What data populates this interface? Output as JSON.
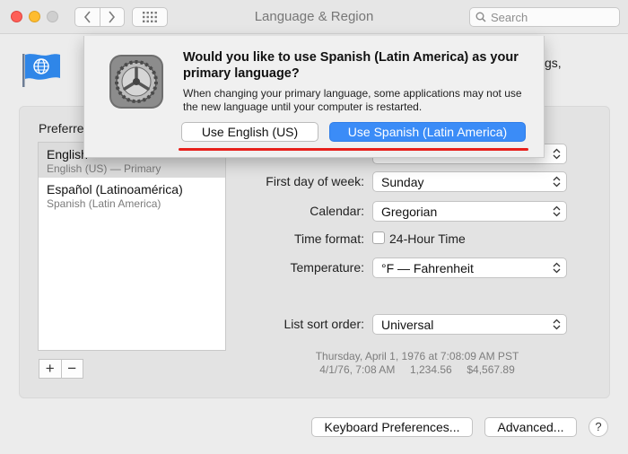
{
  "window": {
    "title": "Language & Region",
    "search_placeholder": "Search"
  },
  "header": {
    "tail_text": "gs,"
  },
  "preferred": {
    "label": "Preferre",
    "languages": [
      {
        "name": "English",
        "subtitle": "English (US) — Primary"
      },
      {
        "name": "Español (Latinoamérica)",
        "subtitle": "Spanish (Latin America)"
      }
    ],
    "add_label": "+",
    "remove_label": "−"
  },
  "settings": {
    "first_day_label": "First day of week:",
    "first_day_value": "Sunday",
    "calendar_label": "Calendar:",
    "calendar_value": "Gregorian",
    "time_format_label": "Time format:",
    "time_format_checkbox": "24-Hour Time",
    "temperature_label": "Temperature:",
    "temperature_value": "°F — Fahrenheit",
    "sort_label": "List sort order:",
    "sort_value": "Universal"
  },
  "sample": {
    "line1": "Thursday, April 1, 1976 at 7:08:09 AM PST",
    "line2": "4/1/76, 7:08 AM     1,234.56     $4,567.89"
  },
  "buttons": {
    "keyboard": "Keyboard Preferences...",
    "advanced": "Advanced...",
    "help": "?"
  },
  "dialog": {
    "title": "Would you like to use Spanish (Latin America) as your primary language?",
    "message": "When changing your primary language, some applications may not use the new language until your computer is restarted.",
    "secondary_button": "Use English (US)",
    "primary_button": "Use Spanish (Latin America)"
  },
  "colors": {
    "primary_button": "#3b8cf7",
    "highlight_line": "#e7201b",
    "close": "#fe5f57",
    "minimize": "#febc2e"
  }
}
